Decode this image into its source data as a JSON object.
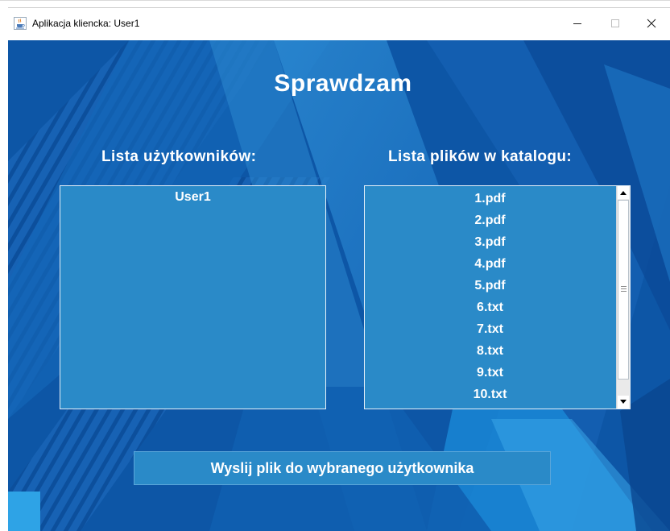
{
  "window": {
    "title": "Aplikacja kliencka: User1",
    "icon": "java-cup-icon",
    "controls": [
      "minimize-icon",
      "maximize-icon",
      "close-icon"
    ]
  },
  "main": {
    "heading": "Sprawdzam",
    "users_label": "Lista użytkowników:",
    "files_label": "Lista plików w katalogu:",
    "users": [
      "User1"
    ],
    "files": [
      "1.pdf",
      "2.pdf",
      "3.pdf",
      "4.pdf",
      "5.pdf",
      "6.txt",
      "7.txt",
      "8.txt",
      "9.txt",
      "10.txt"
    ],
    "send_button": "Wyslij plik do wybranego użytkownika"
  },
  "colors": {
    "background": "#0d56a6",
    "list_background": "#2a8ac8",
    "text": "#ffffff"
  }
}
